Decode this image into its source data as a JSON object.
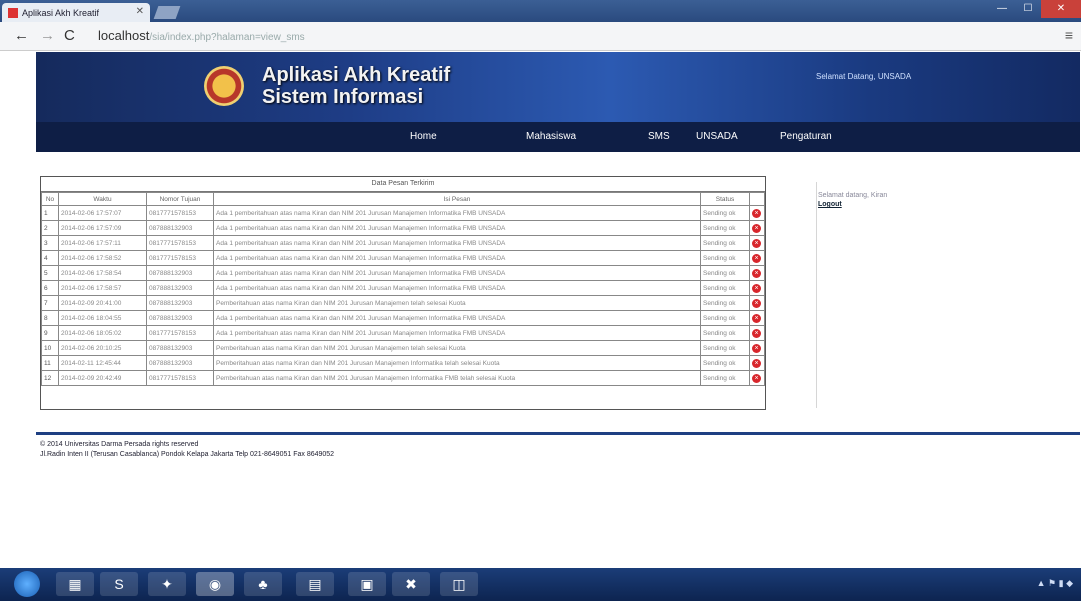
{
  "browser": {
    "tab_title": "Aplikasi Akh Kreatif",
    "url_host": "localhost",
    "url_rest": "/sia/index.php?halaman=view_sms"
  },
  "site": {
    "title_line1": "Aplikasi Akh Kreatif",
    "title_line2": "Sistem Informasi",
    "user_info": "Selamat Datang, UNSADA"
  },
  "menu": {
    "items": [
      "Home",
      "Mahasiswa",
      "SMS",
      "UNSADA",
      "Pengaturan"
    ]
  },
  "inbox": {
    "title": "Data Pesan Terkirim",
    "headers": [
      "No",
      "Waktu",
      "Nomor Tujuan",
      "Isi Pesan",
      "Status",
      ""
    ],
    "rows": [
      {
        "no": "1",
        "waktu": "2014-02-06 17:57:07",
        "nomor": "0817771578153",
        "pesan": "Ada 1 pemberitahuan atas nama Kiran dan NIM 201 Jurusan Manajemen Informatika FMB UNSADA",
        "status": "Sending ok"
      },
      {
        "no": "2",
        "waktu": "2014-02-06 17:57:09",
        "nomor": "087888132903",
        "pesan": "Ada 1 pemberitahuan atas nama Kiran dan NIM 201 Jurusan Manajemen Informatika FMB UNSADA",
        "status": "Sending ok"
      },
      {
        "no": "3",
        "waktu": "2014-02-06 17:57:11",
        "nomor": "0817771578153",
        "pesan": "Ada 1 pemberitahuan atas nama Kiran dan NIM 201 Jurusan Manajemen Informatika FMB UNSADA",
        "status": "Sending ok"
      },
      {
        "no": "4",
        "waktu": "2014-02-06 17:58:52",
        "nomor": "0817771578153",
        "pesan": "Ada 1 pemberitahuan atas nama Kiran dan NIM 201 Jurusan Manajemen Informatika FMB UNSADA",
        "status": "Sending ok"
      },
      {
        "no": "5",
        "waktu": "2014-02-06 17:58:54",
        "nomor": "087888132903",
        "pesan": "Ada 1 pemberitahuan atas nama Kiran dan NIM 201 Jurusan Manajemen Informatika FMB UNSADA",
        "status": "Sending ok"
      },
      {
        "no": "6",
        "waktu": "2014-02-06 17:58:57",
        "nomor": "087888132903",
        "pesan": "Ada 1 pemberitahuan atas nama Kiran dan NIM 201 Jurusan Manajemen Informatika FMB UNSADA",
        "status": "Sending ok"
      },
      {
        "no": "7",
        "waktu": "2014-02-09 20:41:00",
        "nomor": "087888132903",
        "pesan": "Pemberitahuan atas nama Kiran dan NIM 201 Jurusan Manajemen telah selesai Kuota",
        "status": "Sending ok"
      },
      {
        "no": "8",
        "waktu": "2014-02-06 18:04:55",
        "nomor": "087888132903",
        "pesan": "Ada 1 pemberitahuan atas nama Kiran dan NIM 201 Jurusan Manajemen Informatika FMB UNSADA",
        "status": "Sending ok"
      },
      {
        "no": "9",
        "waktu": "2014-02-06 18:05:02",
        "nomor": "0817771578153",
        "pesan": "Ada 1 pemberitahuan atas nama Kiran dan NIM 201 Jurusan Manajemen Informatika FMB UNSADA",
        "status": "Sending ok"
      },
      {
        "no": "10",
        "waktu": "2014-02-06 20:10:25",
        "nomor": "087888132903",
        "pesan": "Pemberitahuan atas nama Kiran dan NIM 201 Jurusan Manajemen telah selesai Kuota",
        "status": "Sending ok"
      },
      {
        "no": "11",
        "waktu": "2014-02-11 12:45:44",
        "nomor": "087888132903",
        "pesan": "Pemberitahuan atas nama Kiran dan NIM 201 Jurusan Manajemen Informatika telah selesai Kuota",
        "status": "Sending ok"
      },
      {
        "no": "12",
        "waktu": "2014-02-09 20:42:49",
        "nomor": "0817771578153",
        "pesan": "Pemberitahuan atas nama Kiran dan NIM 201 Jurusan Manajemen Informatika FMB telah selesai Kuota",
        "status": "Sending ok"
      }
    ]
  },
  "sidebar": {
    "greeting": "Selamat datang, Kiran",
    "logout_label": "Logout"
  },
  "footer": {
    "line1": "© 2014   Universitas Darma Persada rights reserved",
    "line2": "Jl.Radin Inten II (Terusan Casablanca) Pondok Kelapa Jakarta   Telp 021-8649051 Fax 8649052"
  },
  "colors": {
    "banner": "#1e3d86",
    "menubar": "#0e1e45",
    "footer_line": "#1e3f82",
    "delete": "#d8262c"
  }
}
